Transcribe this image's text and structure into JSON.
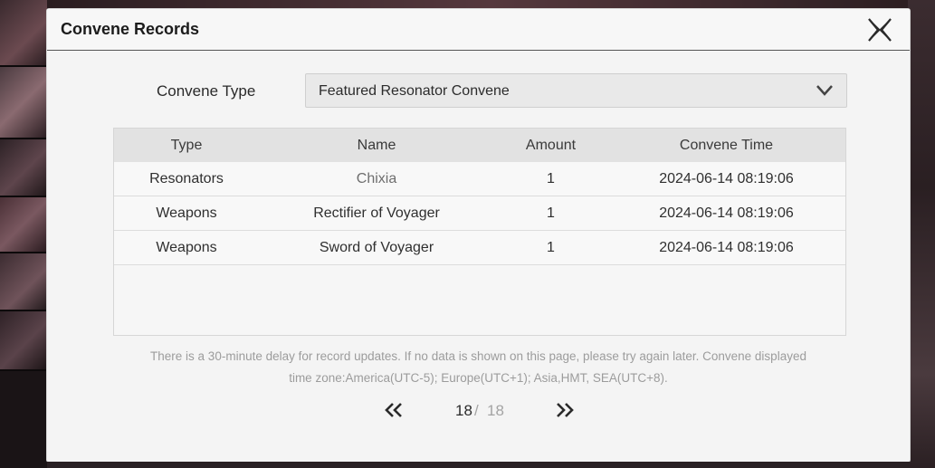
{
  "dialog": {
    "title": "Convene Records",
    "close_icon": "close-x-icon"
  },
  "filter": {
    "label": "Convene Type",
    "selected": "Featured Resonator Convene",
    "chevron_icon": "chevron-down-icon"
  },
  "table": {
    "headers": [
      "Type",
      "Name",
      "Amount",
      "Convene Time"
    ],
    "rows": [
      {
        "type": "Resonators",
        "name": "Chixia",
        "amount": "1",
        "time": "2024-06-14 08:19:06"
      },
      {
        "type": "Weapons",
        "name": "Rectifier of Voyager",
        "amount": "1",
        "time": "2024-06-14 08:19:06"
      },
      {
        "type": "Weapons",
        "name": "Sword of Voyager",
        "amount": "1",
        "time": "2024-06-14 08:19:06"
      }
    ]
  },
  "notice": {
    "line1": "There is a 30-minute delay for record updates. If no data is shown on this page, please try again later. Convene displayed",
    "line2": "time zone:America(UTC-5); Europe(UTC+1); Asia,HMT, SEA(UTC+8)."
  },
  "pagination": {
    "current": "18",
    "separator": "/",
    "total": "18",
    "prev_icon": "double-chevron-left-icon",
    "next_icon": "double-chevron-right-icon"
  },
  "colors": {
    "dialog_bg": "#f4f4f4",
    "header_row_bg": "#e2e2e2",
    "text_primary": "#2f2f2f",
    "text_muted": "#9c9c9c"
  }
}
